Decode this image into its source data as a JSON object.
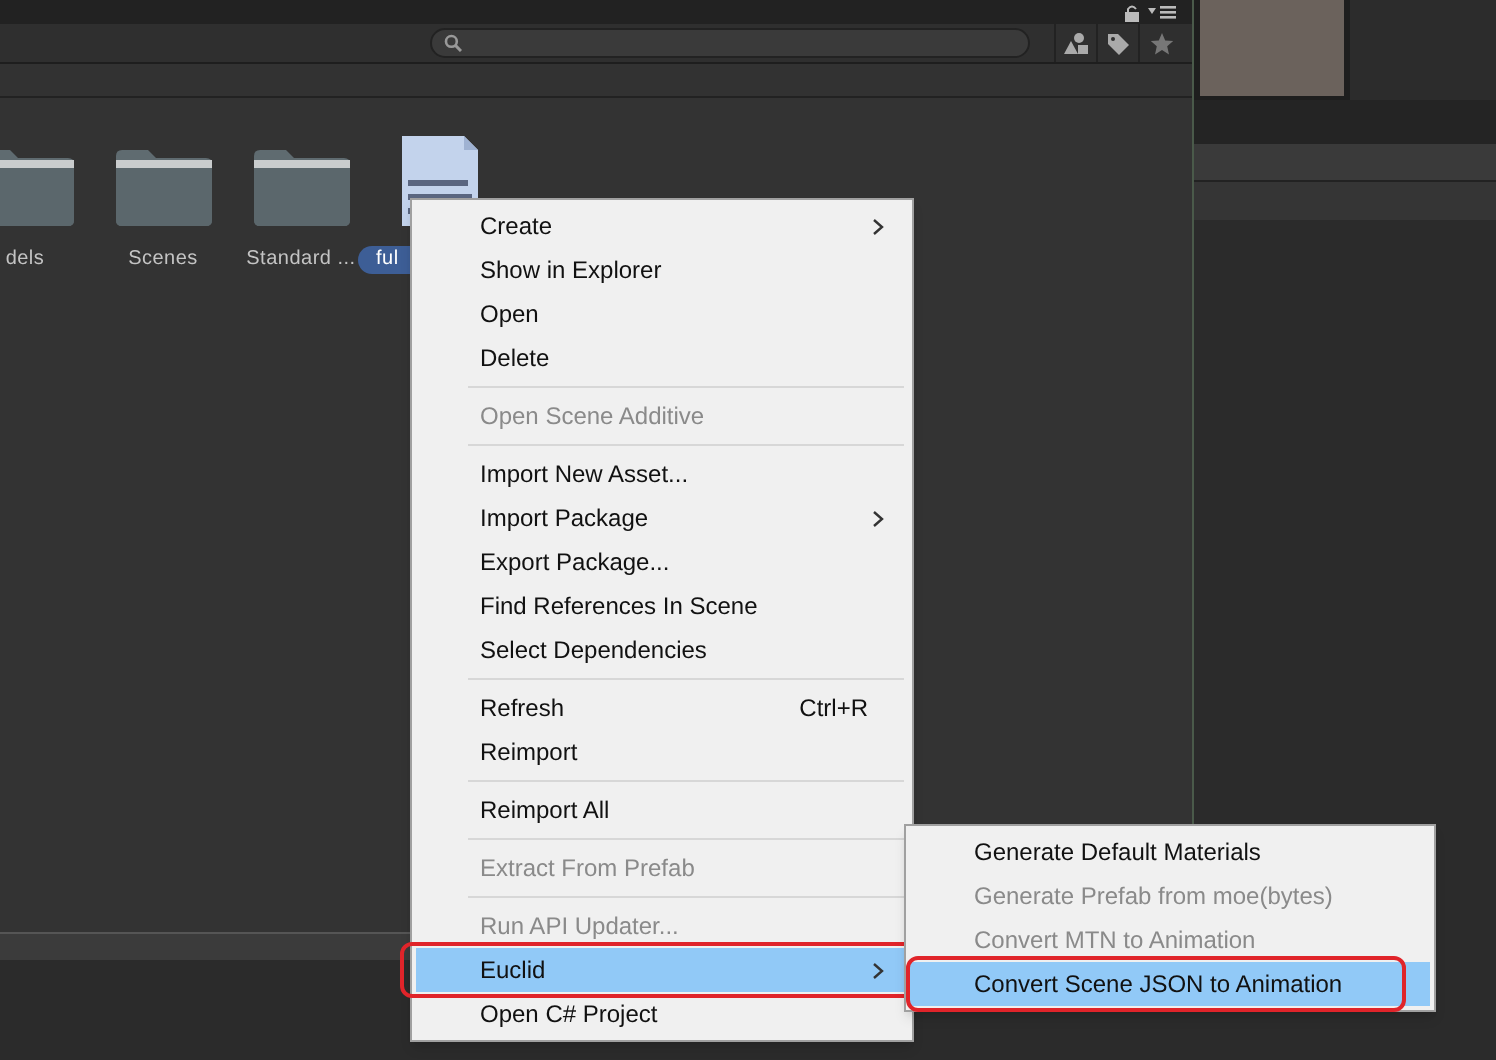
{
  "assets": [
    {
      "label": "dels",
      "kind": "folder",
      "selected": false
    },
    {
      "label": "Scenes",
      "kind": "folder",
      "selected": false
    },
    {
      "label": "Standard ...",
      "kind": "folder",
      "selected": false
    },
    {
      "label": "ful",
      "kind": "document",
      "selected": true
    }
  ],
  "context_menu": {
    "items": [
      {
        "kind": "item",
        "label": "Create",
        "submenu": true,
        "disabled": false,
        "selected": false
      },
      {
        "kind": "item",
        "label": "Show in Explorer",
        "submenu": false,
        "disabled": false,
        "selected": false
      },
      {
        "kind": "item",
        "label": "Open",
        "submenu": false,
        "disabled": false,
        "selected": false
      },
      {
        "kind": "item",
        "label": "Delete",
        "submenu": false,
        "disabled": false,
        "selected": false
      },
      {
        "kind": "separator"
      },
      {
        "kind": "item",
        "label": "Open Scene Additive",
        "submenu": false,
        "disabled": true,
        "selected": false
      },
      {
        "kind": "separator"
      },
      {
        "kind": "item",
        "label": "Import New Asset...",
        "submenu": false,
        "disabled": false,
        "selected": false
      },
      {
        "kind": "item",
        "label": "Import Package",
        "submenu": true,
        "disabled": false,
        "selected": false
      },
      {
        "kind": "item",
        "label": "Export Package...",
        "submenu": false,
        "disabled": false,
        "selected": false
      },
      {
        "kind": "item",
        "label": "Find References In Scene",
        "submenu": false,
        "disabled": false,
        "selected": false
      },
      {
        "kind": "item",
        "label": "Select Dependencies",
        "submenu": false,
        "disabled": false,
        "selected": false
      },
      {
        "kind": "separator"
      },
      {
        "kind": "item",
        "label": "Refresh",
        "shortcut": "Ctrl+R",
        "submenu": false,
        "disabled": false,
        "selected": false
      },
      {
        "kind": "item",
        "label": "Reimport",
        "submenu": false,
        "disabled": false,
        "selected": false
      },
      {
        "kind": "separator"
      },
      {
        "kind": "item",
        "label": "Reimport All",
        "submenu": false,
        "disabled": false,
        "selected": false
      },
      {
        "kind": "separator"
      },
      {
        "kind": "item",
        "label": "Extract From Prefab",
        "submenu": false,
        "disabled": true,
        "selected": false
      },
      {
        "kind": "separator"
      },
      {
        "kind": "item",
        "label": "Run API Updater...",
        "submenu": false,
        "disabled": true,
        "selected": false
      },
      {
        "kind": "item",
        "label": "Euclid",
        "submenu": true,
        "disabled": false,
        "selected": true
      },
      {
        "kind": "item",
        "label": "Open C# Project",
        "submenu": false,
        "disabled": false,
        "selected": false
      }
    ]
  },
  "submenu": {
    "items": [
      {
        "label": "Generate Default Materials",
        "disabled": false,
        "selected": false
      },
      {
        "label": "Generate Prefab from moe(bytes)",
        "disabled": true,
        "selected": false
      },
      {
        "label": "Convert MTN to Animation",
        "disabled": true,
        "selected": false
      },
      {
        "label": "Convert Scene JSON to Animation",
        "disabled": false,
        "selected": true
      }
    ]
  }
}
